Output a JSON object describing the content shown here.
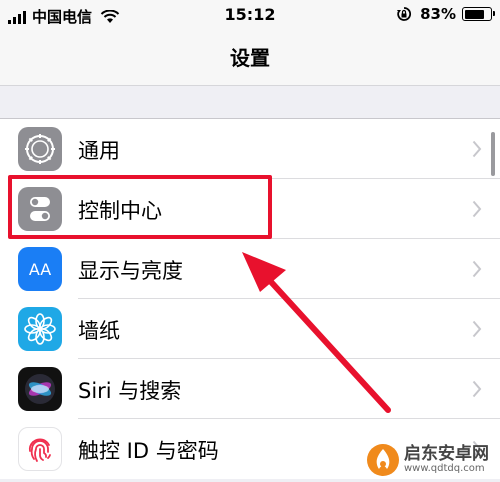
{
  "status_bar": {
    "carrier": "中国电信",
    "time": "15:12",
    "battery_percent": "83%",
    "battery_level": 0.83
  },
  "nav": {
    "title": "设置"
  },
  "settings_items": [
    {
      "label": "通用",
      "icon": "gear-icon"
    },
    {
      "label": "控制中心",
      "icon": "control-center-icon"
    },
    {
      "label": "显示与亮度",
      "icon": "display-brightness-icon",
      "glyph": "AA"
    },
    {
      "label": "墙纸",
      "icon": "wallpaper-flower-icon"
    },
    {
      "label": "Siri 与搜索",
      "icon": "siri-icon"
    },
    {
      "label": "触控 ID 与密码",
      "icon": "fingerprint-icon"
    }
  ],
  "annotation": {
    "color": "#e8112d"
  },
  "watermark": {
    "name": "启东安卓网",
    "url": "www.qdtdq.com"
  }
}
